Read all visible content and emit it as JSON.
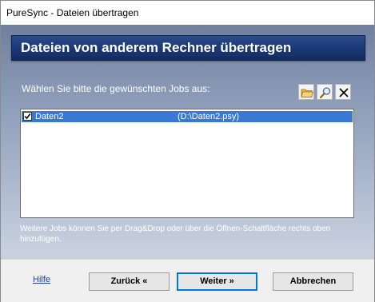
{
  "window": {
    "title": "PureSync - Dateien übertragen"
  },
  "header": {
    "title": "Dateien von anderem Rechner übertragen"
  },
  "prompt": "Wählen Sie bitte die gewünschten Jobs aus:",
  "toolbar": {
    "open_icon": "folder-open-icon",
    "search_icon": "magnifier-icon",
    "delete_icon": "close-x-icon"
  },
  "jobs": [
    {
      "checked": true,
      "name": "Daten2",
      "path": "(D:\\Daten2.psy)"
    }
  ],
  "hint": "Weitere Jobs können Sie per Drag&Drop oder über die Öffnen-Schaltfläche rechts oben hinzufügen.",
  "footer": {
    "help": "Hilfe",
    "back": "Zurück «",
    "next": "Weiter »",
    "cancel": "Abbrechen"
  },
  "colors": {
    "banner": "#1d3b79",
    "selection": "#3b78d6",
    "link": "#1e3fb0"
  }
}
